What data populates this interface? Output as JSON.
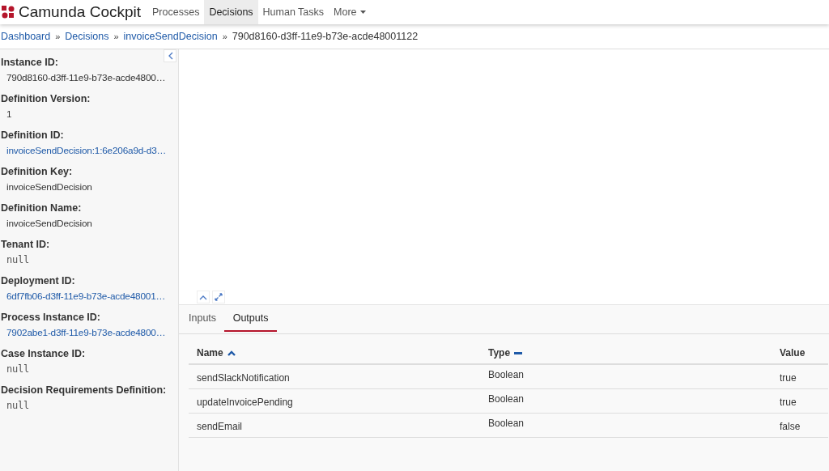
{
  "header": {
    "brand": "Camunda Cockpit",
    "nav": [
      {
        "label": "Processes",
        "selected": false,
        "kind": "link"
      },
      {
        "label": "Decisions",
        "selected": true,
        "kind": "link"
      },
      {
        "label": "Human Tasks",
        "selected": false,
        "kind": "link"
      },
      {
        "label": "More",
        "selected": false,
        "kind": "dropdown"
      }
    ]
  },
  "breadcrumb": {
    "links": [
      "Dashboard",
      "Decisions",
      "invoiceSendDecision"
    ],
    "separator": "»",
    "current": "790d8160-d3ff-11e9-b73e-acde48001122"
  },
  "sidebar": {
    "fields": [
      {
        "label": "Instance ID:",
        "value": "790d8160-d3ff-11e9-b73e-acde4800…",
        "kind": "text"
      },
      {
        "label": "Definition Version:",
        "value": "1",
        "kind": "text"
      },
      {
        "label": "Definition ID:",
        "value": "invoiceSendDecision:1:6e206a9d-d3…",
        "kind": "link"
      },
      {
        "label": "Definition Key:",
        "value": "invoiceSendDecision",
        "kind": "text"
      },
      {
        "label": "Definition Name:",
        "value": "invoiceSendDecision",
        "kind": "text"
      },
      {
        "label": "Tenant ID:",
        "value": "null",
        "kind": "mono"
      },
      {
        "label": "Deployment ID:",
        "value": "6df7fb06-d3ff-11e9-b73e-acde48001…",
        "kind": "link"
      },
      {
        "label": "Process Instance ID:",
        "value": "7902abe1-d3ff-11e9-b73e-acde4800…",
        "kind": "link"
      },
      {
        "label": "Case Instance ID:",
        "value": "null",
        "kind": "mono"
      },
      {
        "label": "Decision Requirements Definition:",
        "value": "null",
        "kind": "mono"
      }
    ]
  },
  "tabs": [
    {
      "label": "Inputs",
      "selected": false
    },
    {
      "label": "Outputs",
      "selected": true
    }
  ],
  "table": {
    "columns": [
      {
        "label": "Name",
        "kind": "sorted"
      },
      {
        "label": "Type",
        "kind": "sortable"
      },
      {
        "label": "Value",
        "kind": "plain"
      }
    ],
    "rows": [
      [
        "sendSlackNotification",
        "Boolean",
        "true"
      ],
      [
        "updateInvoicePending",
        "Boolean",
        "true"
      ],
      [
        "sendEmail",
        "Boolean",
        "false"
      ]
    ]
  }
}
